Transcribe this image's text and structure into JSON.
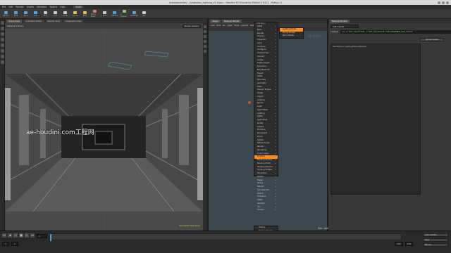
{
  "window": {
    "title": "/home/morten/.../shots/hou_lighting_v1.hipnc - Houdini FX Education Edition 19.0.5 - Python 3"
  },
  "menubar": {
    "items": [
      "File",
      "Edit",
      "Render",
      "Assets",
      "Windows",
      "Solaris",
      "Help"
    ],
    "desktop": "Build"
  },
  "shelf": {
    "tools": [
      {
        "label": "Sphere",
        "color": "#5ea3d8"
      },
      {
        "label": "Tube",
        "color": "#5ea3d8"
      },
      {
        "label": "Torus",
        "color": "#5ea3d8"
      },
      {
        "label": "Grid",
        "color": "#5ea3d8"
      },
      {
        "label": "Null",
        "color": "#cfcfcf"
      },
      {
        "label": "Line",
        "color": "#cfcfcf"
      },
      {
        "label": "Circle",
        "color": "#cfcfcf"
      },
      {
        "label": "Curve",
        "color": "#e0c05a"
      },
      {
        "label": "Path",
        "color": "#e0c05a"
      },
      {
        "label": "Spray Paint",
        "color": "#d87a5e"
      },
      {
        "label": "Font",
        "color": "#cfcfcf"
      },
      {
        "label": "Platonic",
        "color": "#5ea3d8"
      },
      {
        "label": "L-System",
        "color": "#8acb6a"
      },
      {
        "label": "Metaball",
        "color": "#5ea3d8"
      },
      {
        "label": "File",
        "color": "#cfcfcf"
      }
    ]
  },
  "viewport": {
    "tabs": [
      "Scene View",
      "Animation Editor",
      "Render View",
      "Composite View"
    ],
    "header": "Material Library",
    "camera": "Render Camera",
    "watermark": "ae-houdini.com工程网",
    "status_tag": "Persistent Renderer"
  },
  "network": {
    "tabs": [
      "/stage",
      "Material Palette"
    ],
    "menu": [
      "Add",
      "Edit",
      "Go",
      "View",
      "Tools",
      "Layout",
      "Help"
    ],
    "bg_label": "Builder",
    "tip": "Tab - Add Operator"
  },
  "tab_menu": {
    "header": "TAB Menu",
    "items": [
      "Attrib",
      "BLTD",
      "Bundle",
      "Camera",
      "Collection",
      "Color",
      "Combine",
      "Configure",
      "Control Flow",
      "Convert",
      "Crowd",
      "Digital Assets",
      "Dynamics",
      "Edit Materials",
      "Export",
      "Gates",
      "Generate",
      "Geometry",
      "Hdas",
      "Houdini Engine",
      "Image",
      "Import",
      "Instance",
      "Karma",
      "Light",
      "Light Filters",
      "Lighting",
      "Lights",
      "Light Mixer",
      "Modify",
      "Output",
      "Primitive",
      "Procedural",
      "Prune",
      "Python",
      "Python Script",
      "Render",
      "Rendering",
      "Scene Graph",
      "Shading",
      "Shading (Hydra)",
      "Shading (USD)",
      "Shading (Karma)",
      "Shading Utilities",
      "Simulation",
      "Solaris",
      "Stage",
      "String",
      "Subnet",
      "Subnetworks",
      "Switch",
      "Transform",
      "Utility",
      "Variants",
      "Vex",
      "Volume"
    ],
    "highlighted_index": 39
  },
  "submenu": {
    "items": [
      "Lighting Model",
      "Phong Shader",
      "Blinn Shader"
    ],
    "highlighted_index": 0
  },
  "history_menu": {
    "items": [
      "History",
      "Material Builder",
      "Flat Light Shader",
      "Karma Light",
      "USD Preview Surface",
      "Assign Material",
      "Back Cr..."
    ]
  },
  "params": {
    "tab": "Material Builder",
    "node_name": "mat_builder",
    "script_label": "Content",
    "script": "vex -q 'SOP_COLLECTIVE' -o 'SOP_COLLECTIVE | SOP_ENSEMBLE_SOP_XXXXX'",
    "button": "Reload Assets",
    "area_text": "Subnetwork: Lighting/MaterialBuilder"
  },
  "playbar": {
    "frame": "1",
    "start": "1",
    "end": "240",
    "range_end": "240",
    "buttons": [
      "Auto Update",
      "Keys",
      "Record"
    ]
  },
  "colors": {
    "accent": "#ff8c1a",
    "network_bg": "#3b4850",
    "playhead": "#3fa9f5"
  }
}
